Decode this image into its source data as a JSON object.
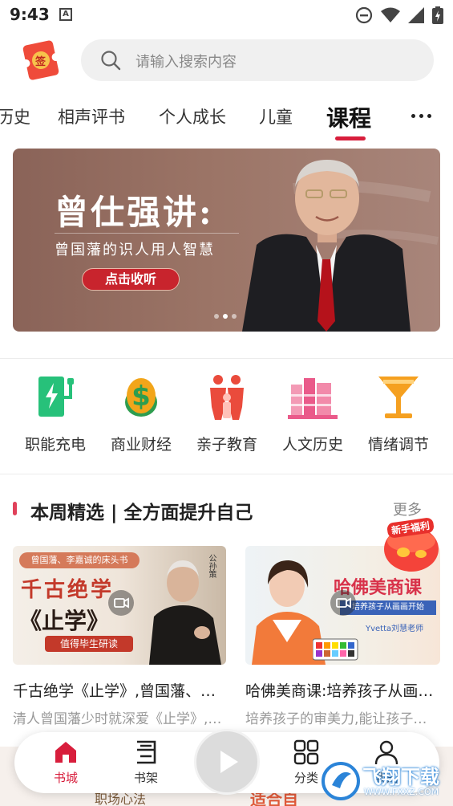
{
  "status_bar": {
    "time": "9:43",
    "app_icon_letter": "A"
  },
  "header": {
    "search_placeholder": "请输入搜索内容",
    "logo_text": "签"
  },
  "tabs": [
    {
      "label": "历史"
    },
    {
      "label": "相声评书"
    },
    {
      "label": "个人成长"
    },
    {
      "label": "儿童"
    },
    {
      "label": "课程",
      "active": true
    }
  ],
  "banner": {
    "title": "曾仕强讲:",
    "subtitle": "曾国藩的识人用人智慧",
    "button": "点击收听"
  },
  "categories": [
    {
      "label": "职能充电",
      "icon": "charging-icon",
      "color": "#27c17a"
    },
    {
      "label": "商业财经",
      "icon": "dollar-icon",
      "color": "#f2a51a"
    },
    {
      "label": "亲子教育",
      "icon": "family-icon",
      "color": "#ea4b3c"
    },
    {
      "label": "人文历史",
      "icon": "books-icon",
      "color": "#ea5a8a"
    },
    {
      "label": "情绪调节",
      "icon": "cocktail-icon",
      "color": "#f5a020"
    }
  ],
  "weekly": {
    "title": "本周精选 | 全方面提升自己",
    "more": "更多",
    "gift_label": "新手福利",
    "cards": [
      {
        "title": "千古绝学《止学》,曾国藩、李嘉诚的床头书",
        "desc": "清人曾国藩少时就深爱《止学》,时时研读",
        "thumb_top": "曾国藩、李嘉诚的床头书",
        "thumb_main1": "千古绝学",
        "thumb_main2": "《止学》",
        "thumb_tag": "值得毕生研读",
        "thumb_side": "公孙策"
      },
      {
        "title": "哈佛美商课:培养孩子从画画开始",
        "desc": "培养孩子的审美力,能让孩子受益一生",
        "thumb_main": "哈佛美商课",
        "thumb_sub": "培养孩子从画画开始",
        "thumb_teacher": "Yvetta刘慧老师"
      }
    ]
  },
  "bottom_nav": [
    {
      "label": "书城",
      "active": true
    },
    {
      "label": "书架"
    },
    {
      "label": "分类"
    },
    {
      "label": "我的"
    }
  ],
  "peek_texts": {
    "left": "职场心法",
    "right": "适合自"
  },
  "watermark": {
    "text": "飞翔下载",
    "url": "WWW.FXXZ.COM"
  },
  "colors": {
    "accent": "#d81e3c",
    "banner_bg": "#8a6358"
  }
}
